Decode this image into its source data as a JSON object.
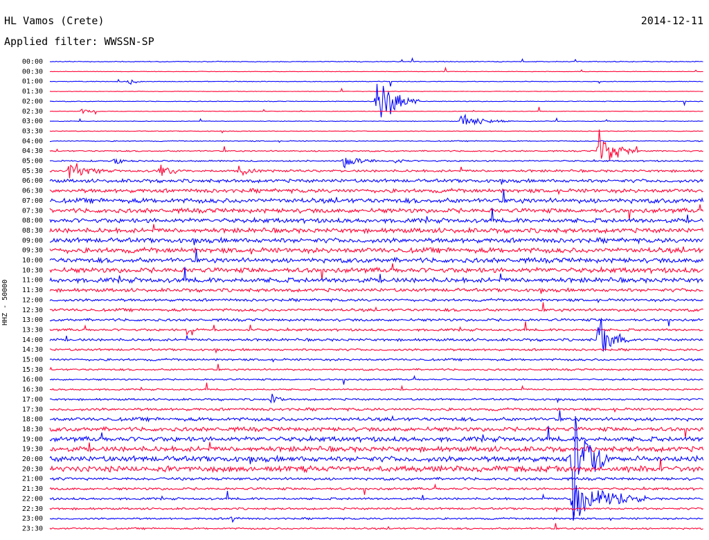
{
  "header": {
    "station": "HL Vamos (Crete)",
    "date": "2014-12-11",
    "filter": "Applied filter: WWSSN-SP"
  },
  "colors": {
    "trace_a": "#0000ff",
    "trace_b": "#ff0033"
  },
  "chart_data": {
    "type": "line",
    "title": "HL Vamos (Crete)",
    "ylabel": "HHZ - 50000",
    "row_labels": [
      "00:00",
      "00:30",
      "01:00",
      "01:30",
      "02:00",
      "02:30",
      "03:00",
      "03:30",
      "04:00",
      "04:30",
      "05:00",
      "05:30",
      "06:00",
      "06:30",
      "07:00",
      "07:30",
      "08:00",
      "08:30",
      "09:00",
      "09:30",
      "10:00",
      "10:30",
      "11:00",
      "11:30",
      "12:00",
      "12:30",
      "13:00",
      "13:30",
      "14:00",
      "14:30",
      "15:00",
      "15:30",
      "16:00",
      "16:30",
      "17:00",
      "17:30",
      "18:00",
      "18:30",
      "19:00",
      "19:30",
      "20:00",
      "20:30",
      "21:00",
      "21:30",
      "22:00",
      "22:30",
      "23:00",
      "23:30"
    ],
    "row_colors": [
      "blue",
      "red"
    ],
    "noise_level": [
      0.5,
      0.3,
      0.4,
      0.3,
      0.4,
      0.3,
      0.4,
      0.4,
      0.6,
      0.8,
      0.9,
      1.4,
      2.0,
      2.3,
      2.8,
      2.6,
      2.6,
      2.7,
      2.8,
      3.0,
      2.8,
      2.9,
      2.8,
      2.0,
      1.6,
      1.7,
      1.5,
      1.4,
      1.5,
      1.3,
      1.3,
      1.1,
      1.0,
      1.0,
      1.2,
      1.6,
      2.1,
      2.4,
      2.8,
      3.0,
      3.2,
      3.3,
      1.6,
      1.4,
      1.3,
      1.2,
      1.1,
      1.0
    ],
    "events": [
      {
        "row": 2,
        "x": 0.12,
        "amp": 12,
        "dur": 0.02
      },
      {
        "row": 4,
        "x": 0.5,
        "amp": 48,
        "dur": 0.07
      },
      {
        "row": 5,
        "x": 0.05,
        "amp": 5,
        "dur": 0.03
      },
      {
        "row": 6,
        "x": 0.63,
        "amp": 12,
        "dur": 0.08
      },
      {
        "row": 9,
        "x": 0.84,
        "amp": 40,
        "dur": 0.06
      },
      {
        "row": 10,
        "x": 0.45,
        "amp": 14,
        "dur": 0.05
      },
      {
        "row": 10,
        "x": 0.1,
        "amp": 8,
        "dur": 0.02
      },
      {
        "row": 10,
        "x": 0.53,
        "amp": 7,
        "dur": 0.02
      },
      {
        "row": 11,
        "x": 0.03,
        "amp": 18,
        "dur": 0.06
      },
      {
        "row": 11,
        "x": 0.17,
        "amp": 12,
        "dur": 0.04
      },
      {
        "row": 11,
        "x": 0.29,
        "amp": 10,
        "dur": 0.04
      },
      {
        "row": 27,
        "x": 0.21,
        "amp": 8,
        "dur": 0.02
      },
      {
        "row": 28,
        "x": 0.84,
        "amp": 45,
        "dur": 0.05
      },
      {
        "row": 34,
        "x": 0.34,
        "amp": 10,
        "dur": 0.02
      },
      {
        "row": 40,
        "x": 0.8,
        "amp": 120,
        "dur": 0.06
      },
      {
        "row": 44,
        "x": 0.8,
        "amp": 40,
        "dur": 0.12
      },
      {
        "row": 46,
        "x": 0.28,
        "amp": 18,
        "dur": 0.01
      }
    ]
  }
}
